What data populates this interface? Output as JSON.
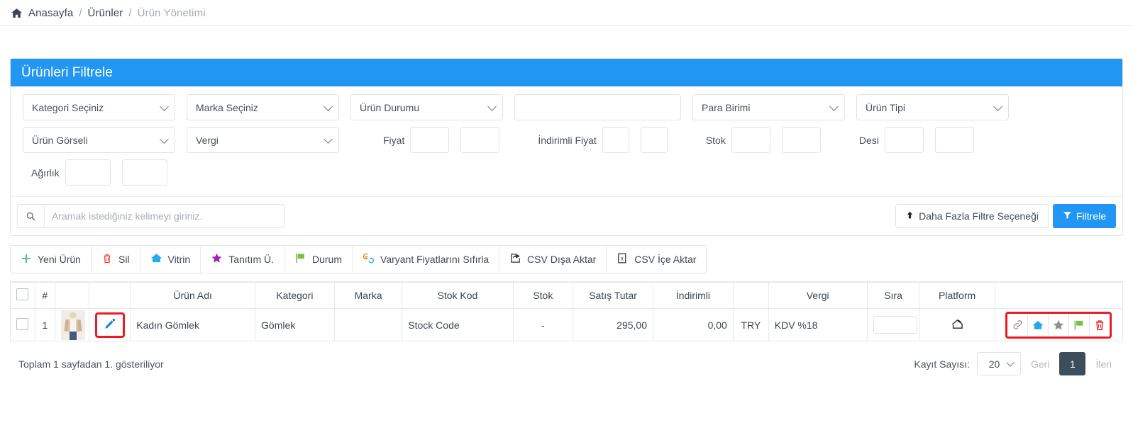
{
  "breadcrumb": {
    "home_icon": "home-icon",
    "items": [
      "Anasayfa",
      "Ürünler",
      "Ürün Yönetimi"
    ],
    "separator": "/"
  },
  "filter_panel": {
    "title": "Ürünleri Filtrele",
    "row1": [
      {
        "label": "Kategori Seçiniz",
        "type": "select"
      },
      {
        "label": "Marka Seçiniz",
        "type": "select"
      },
      {
        "label": "Ürün Durumu",
        "type": "select"
      },
      {
        "label": "",
        "type": "text"
      },
      {
        "label": "Para Birimi",
        "type": "select"
      },
      {
        "label": "Ürün Tipi",
        "type": "select"
      }
    ],
    "row2": {
      "urun_gorseli": "Ürün Görseli",
      "vergi": "Vergi",
      "fiyat": "Fiyat",
      "indirimli_fiyat": "İndirimli Fiyat",
      "stok": "Stok",
      "desi": "Desi"
    },
    "row3": {
      "agirlik": "Ağırlık"
    },
    "search": {
      "placeholder": "Aramak istediğiniz kelimeyi giriniz.",
      "value": "",
      "icon": "search-icon"
    },
    "more_button": {
      "label": "Daha Fazla Filtre Seçeneği",
      "icon": "arrow-up-icon"
    },
    "filter_button": {
      "label": "Filtrele",
      "icon": "funnel-icon",
      "color": "#2196f3"
    }
  },
  "toolbar": [
    {
      "label": "Yeni Ürün",
      "icon": "plus-icon",
      "color": "#3ec46d"
    },
    {
      "label": "Sil",
      "icon": "trash-icon",
      "color": "#e8443a"
    },
    {
      "label": "Vitrin",
      "icon": "home-icon",
      "color": "#29a9e8"
    },
    {
      "label": "Tanıtım Ü.",
      "icon": "star-icon",
      "color": "#9c27b0"
    },
    {
      "label": "Durum",
      "icon": "flag-icon",
      "color": "#7bc043"
    },
    {
      "label": "Varyant Fiyatlarını Sıfırla",
      "icon": "refresh-price-icon",
      "color": "#f08a24"
    },
    {
      "label": "CSV Dışa Aktar",
      "icon": "export-icon",
      "color": "#2c3137"
    },
    {
      "label": "CSV İçe Aktar",
      "icon": "excel-import-icon",
      "color": "#2c3137"
    }
  ],
  "table": {
    "headers": [
      "",
      "#",
      "",
      "",
      "Ürün Adı",
      "Kategori",
      "Marka",
      "Stok Kod",
      "Stok",
      "Satış Tutar",
      "İndirimli",
      "",
      "Vergi",
      "Sıra",
      "Platform",
      ""
    ],
    "rows": [
      {
        "index": "1",
        "thumbnail": "product-photo",
        "edit_icon": "pencil-icon",
        "name": "Kadın Gömlek",
        "category": "Gömlek",
        "brand": "",
        "stock_code": "Stock Code",
        "stock": "-",
        "price": "295,00",
        "discount": "0,00",
        "currency": "TRY",
        "vat": "KDV %18",
        "order": "",
        "platform_icon": "house-share-icon",
        "actions": [
          {
            "icon": "link-icon",
            "color": "#8c9398"
          },
          {
            "icon": "home-icon",
            "color": "#29a9e8"
          },
          {
            "icon": "star-icon",
            "color": "#8c9398"
          },
          {
            "icon": "flag-icon",
            "color": "#7bc043"
          },
          {
            "icon": "trash-icon",
            "color": "#ed1c24"
          }
        ]
      }
    ]
  },
  "footer": {
    "summary": "Toplam 1 sayfadan 1. gösteriliyor",
    "page_size_label": "Kayıt Sayısı:",
    "page_size_value": "20",
    "prev_label": "Geri",
    "current_page": "1",
    "next_label": "İleri"
  }
}
